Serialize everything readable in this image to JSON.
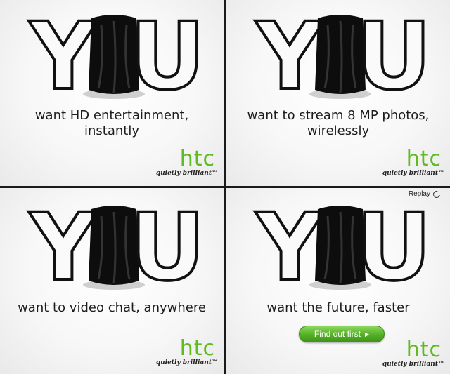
{
  "panels": [
    {
      "headline_letters": [
        "Y",
        "U"
      ],
      "tagline": [
        "want HD entertainment,",
        "instantly"
      ]
    },
    {
      "headline_letters": [
        "Y",
        "U"
      ],
      "tagline": [
        "want to stream 8 MP photos,",
        "wirelessly"
      ]
    },
    {
      "headline_letters": [
        "Y",
        "U"
      ],
      "tagline": [
        "want to video chat, anywhere"
      ]
    },
    {
      "headline_letters": [
        "Y",
        "U"
      ],
      "tagline": [
        "want the future, faster"
      ],
      "cta_label": "Find out first"
    }
  ],
  "brand": {
    "logo": "htc",
    "slogan": "quietly brilliant",
    "trademark": "™",
    "logo_color": "#5fbb1f"
  },
  "replay_label": "Replay",
  "icons": {
    "replay": "replay-icon",
    "cta_arrow": "play-arrow-icon",
    "cloaked_figure": "cloaked-figure-icon"
  }
}
